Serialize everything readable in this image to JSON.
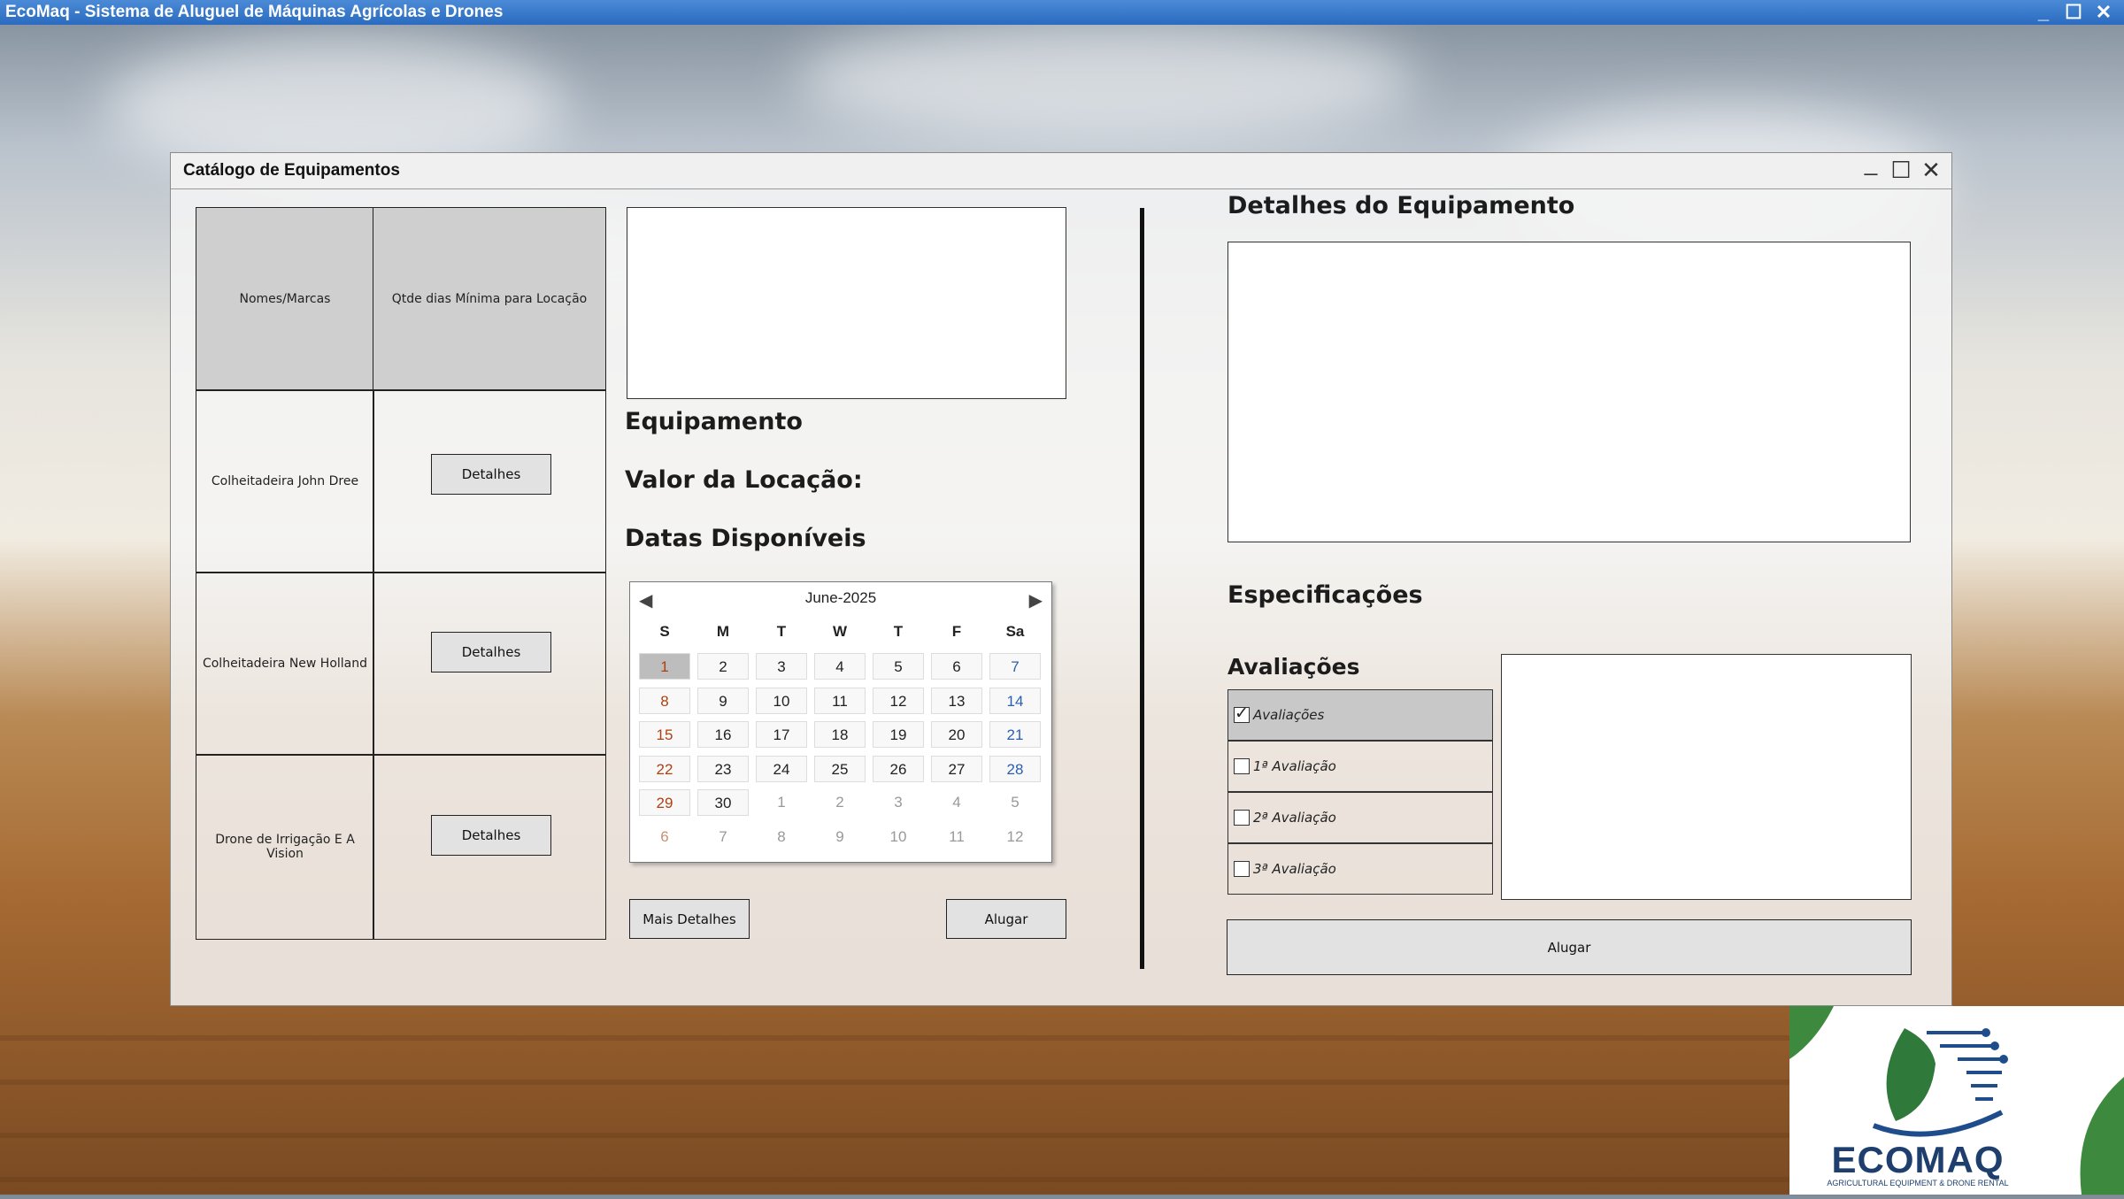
{
  "app": {
    "title": "EcoMaq - Sistema de Aluguel de Máquinas Agrícolas e Drones"
  },
  "window": {
    "title": "Catálogo de Equipamentos"
  },
  "table": {
    "headers": [
      "Nomes/Marcas",
      "Qtde dias Mínima para Locação"
    ],
    "rows": [
      {
        "name": "Colheitadeira John Dree",
        "button": "Detalhes"
      },
      {
        "name": "Colheitadeira New Holland",
        "button": "Detalhes"
      },
      {
        "name": "Drone de Irrigação E A Vision",
        "button": "Detalhes"
      }
    ]
  },
  "info": {
    "equipamento": "Equipamento",
    "valor": "Valor da Locação:",
    "datas": "Datas Disponíveis"
  },
  "calendar": {
    "month": "June-2025",
    "weekdays": [
      "S",
      "M",
      "T",
      "W",
      "T",
      "F",
      "Sa"
    ],
    "selected_day": "1",
    "weeks": [
      [
        "1",
        "2",
        "3",
        "4",
        "5",
        "6",
        "7"
      ],
      [
        "8",
        "9",
        "10",
        "11",
        "12",
        "13",
        "14"
      ],
      [
        "15",
        "16",
        "17",
        "18",
        "19",
        "20",
        "21"
      ],
      [
        "22",
        "23",
        "24",
        "25",
        "26",
        "27",
        "28"
      ],
      [
        "29",
        "30",
        "1",
        "2",
        "3",
        "4",
        "5"
      ],
      [
        "6",
        "7",
        "8",
        "9",
        "10",
        "11",
        "12"
      ]
    ]
  },
  "buttons": {
    "mais_detalhes": "Mais Detalhes",
    "alugar_left": "Alugar",
    "alugar_right": "Alugar"
  },
  "details": {
    "title": "Detalhes do Equipamento",
    "especificacoes": "Especificações",
    "avaliacoes_title": "Avaliações",
    "avaliacoes": [
      {
        "label": "Avaliações",
        "checked": true
      },
      {
        "label": "1ª Avaliação",
        "checked": false
      },
      {
        "label": "2ª Avaliação",
        "checked": false
      },
      {
        "label": "3ª Avaliação",
        "checked": false
      }
    ]
  },
  "logo": {
    "name": "ECOMAQ",
    "tagline": "AGRICULTURAL EQUIPMENT & DRONE RENTAL"
  },
  "colors": {
    "titlebar": "#2b6bc0",
    "logo_green": "#2f7a3a",
    "logo_blue": "#1f4d8c"
  }
}
